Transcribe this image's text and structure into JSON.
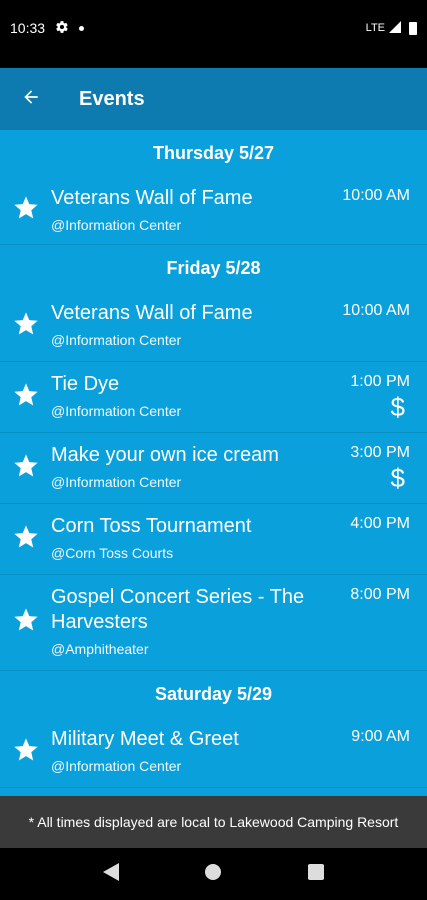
{
  "status_bar": {
    "time": "10:33",
    "network": "LTE"
  },
  "app_bar": {
    "title": "Events"
  },
  "days": [
    {
      "label": "Thursday 5/27",
      "events": [
        {
          "title": "Veterans Wall of Fame",
          "location": "@Information Center",
          "time": "10:00 AM",
          "price": ""
        }
      ]
    },
    {
      "label": "Friday 5/28",
      "events": [
        {
          "title": "Veterans Wall of Fame",
          "location": "@Information Center",
          "time": "10:00 AM",
          "price": ""
        },
        {
          "title": "Tie Dye",
          "location": "@Information Center",
          "time": "1:00 PM",
          "price": "$"
        },
        {
          "title": "Make your own ice cream",
          "location": "@Information Center",
          "time": "3:00 PM",
          "price": "$"
        },
        {
          "title": "Corn Toss Tournament",
          "location": "@Corn Toss Courts",
          "time": "4:00 PM",
          "price": ""
        },
        {
          "title": "Gospel Concert Series - The Harvesters",
          "location": "@Amphitheater",
          "time": "8:00 PM",
          "price": ""
        }
      ]
    },
    {
      "label": "Saturday 5/29",
      "events": [
        {
          "title": "Military Meet & Greet",
          "location": "@Information Center",
          "time": "9:00 AM",
          "price": ""
        }
      ]
    }
  ],
  "footer": {
    "note": "* All times displayed are local to Lakewood Camping Resort"
  },
  "colors": {
    "app_bar": "#0e7bb0",
    "content_bg": "#0aa0db",
    "footer_bg": "#3a3a3a"
  },
  "icons": {
    "back": "arrow-left-icon",
    "favorite": "star-icon",
    "price": "dollar-icon",
    "settings": "gear-icon"
  }
}
